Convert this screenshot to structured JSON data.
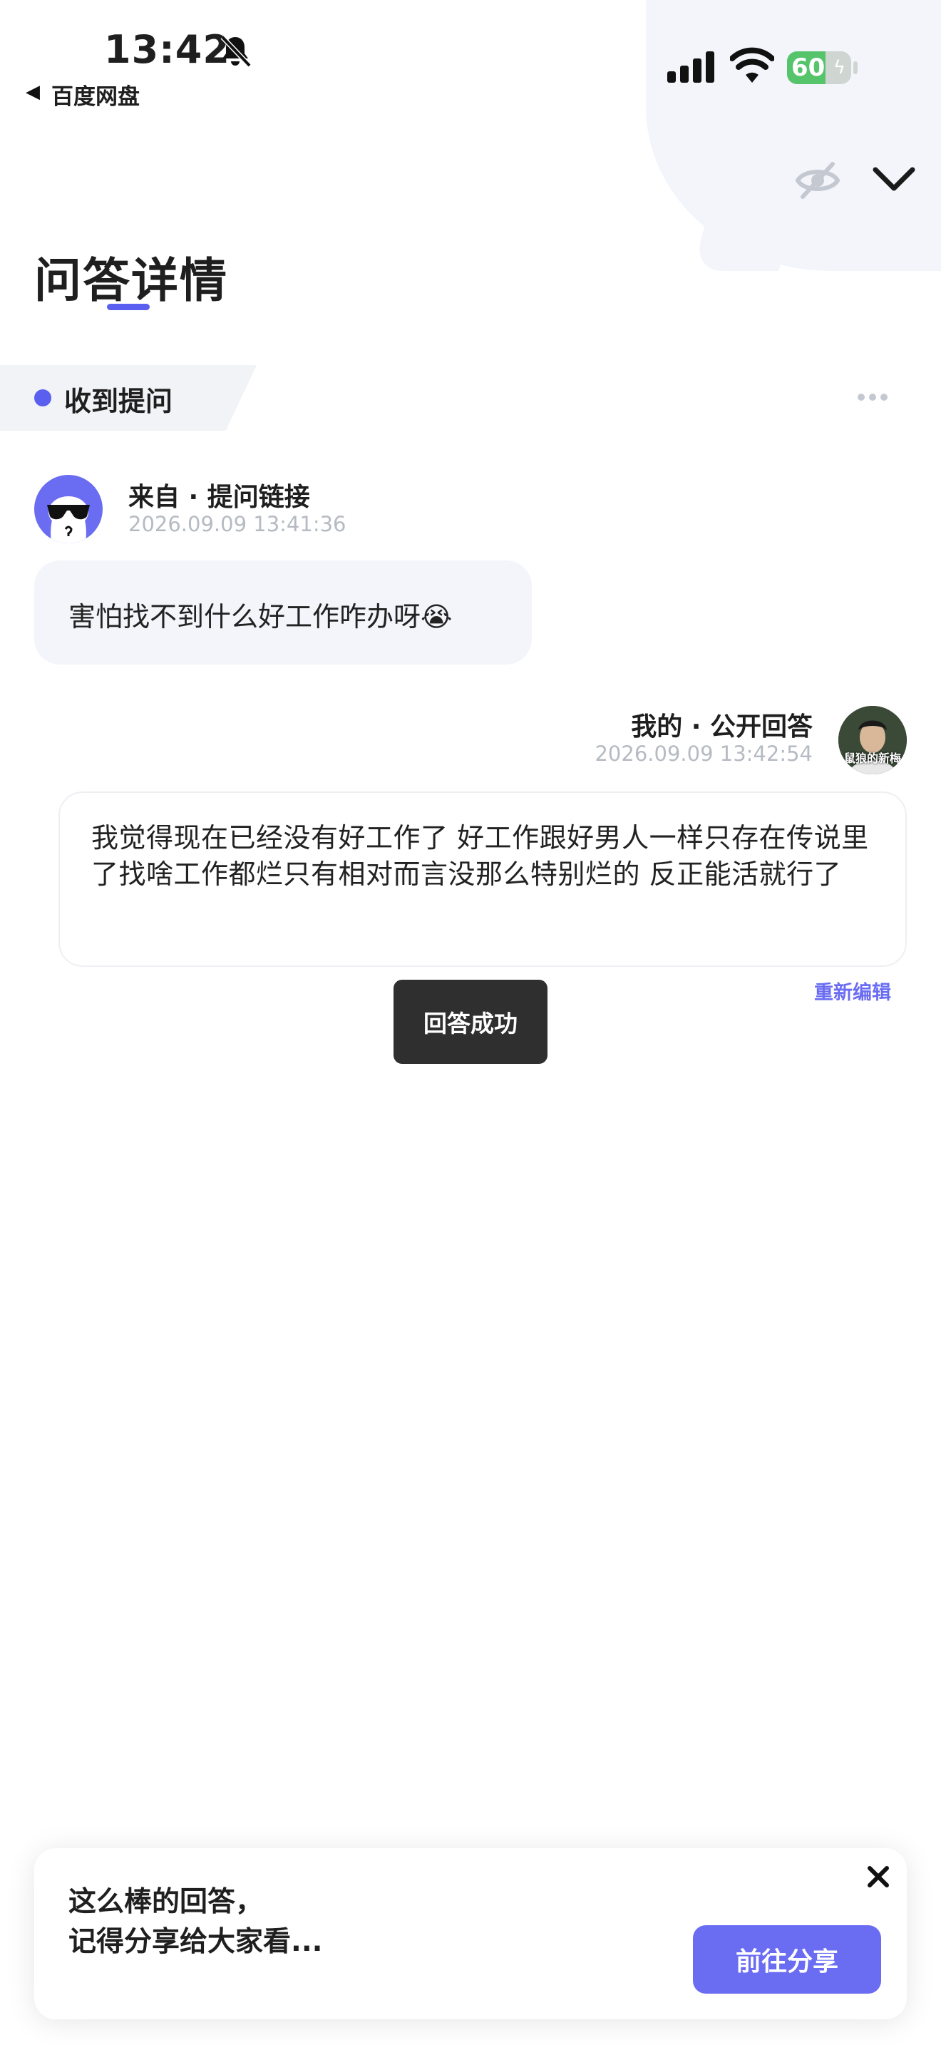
{
  "status_bar": {
    "time": "13:42",
    "back_app": "百度网盘",
    "battery_level": "60",
    "battery_percent": 60,
    "icons": [
      "bell-slash-icon",
      "signal-icon",
      "wifi-icon",
      "battery-charging-icon"
    ]
  },
  "header": {
    "title": "问答详情",
    "icons": [
      "eye-off-icon",
      "chevron-down-icon"
    ]
  },
  "section": {
    "title": "收到提问",
    "more_icon": "more-dots-icon"
  },
  "question": {
    "source": "来自 · 提问链接",
    "timestamp": "2026.09.09 13:41:36",
    "text": "害怕找不到什么好工作咋办呀😭"
  },
  "answer": {
    "title": "我的 · 公开回答",
    "timestamp": "2026.09.09 13:42:54",
    "avatar_caption": "鼠狼的新梅",
    "text": "我觉得现在已经没有好工作了 好工作跟好男人一样只存在传说里了找啥工作都烂只有相对而言没那么特别烂的 反正能活就行了",
    "reedit_label": "重新编辑"
  },
  "toast": {
    "text": "回答成功"
  },
  "share_card": {
    "line1": "这么棒的回答，",
    "line2": "记得分享给大家看...",
    "button_label": "前往分享",
    "close_icon": "close-icon"
  },
  "colors": {
    "accent": "#6a6cf2",
    "title_underline": "#5b5ff0",
    "bubble_bg": "#f3f5fb",
    "timestamp": "#b6bac3",
    "toast_bg": "#2f2f2f",
    "battery_green": "#55c46a"
  }
}
